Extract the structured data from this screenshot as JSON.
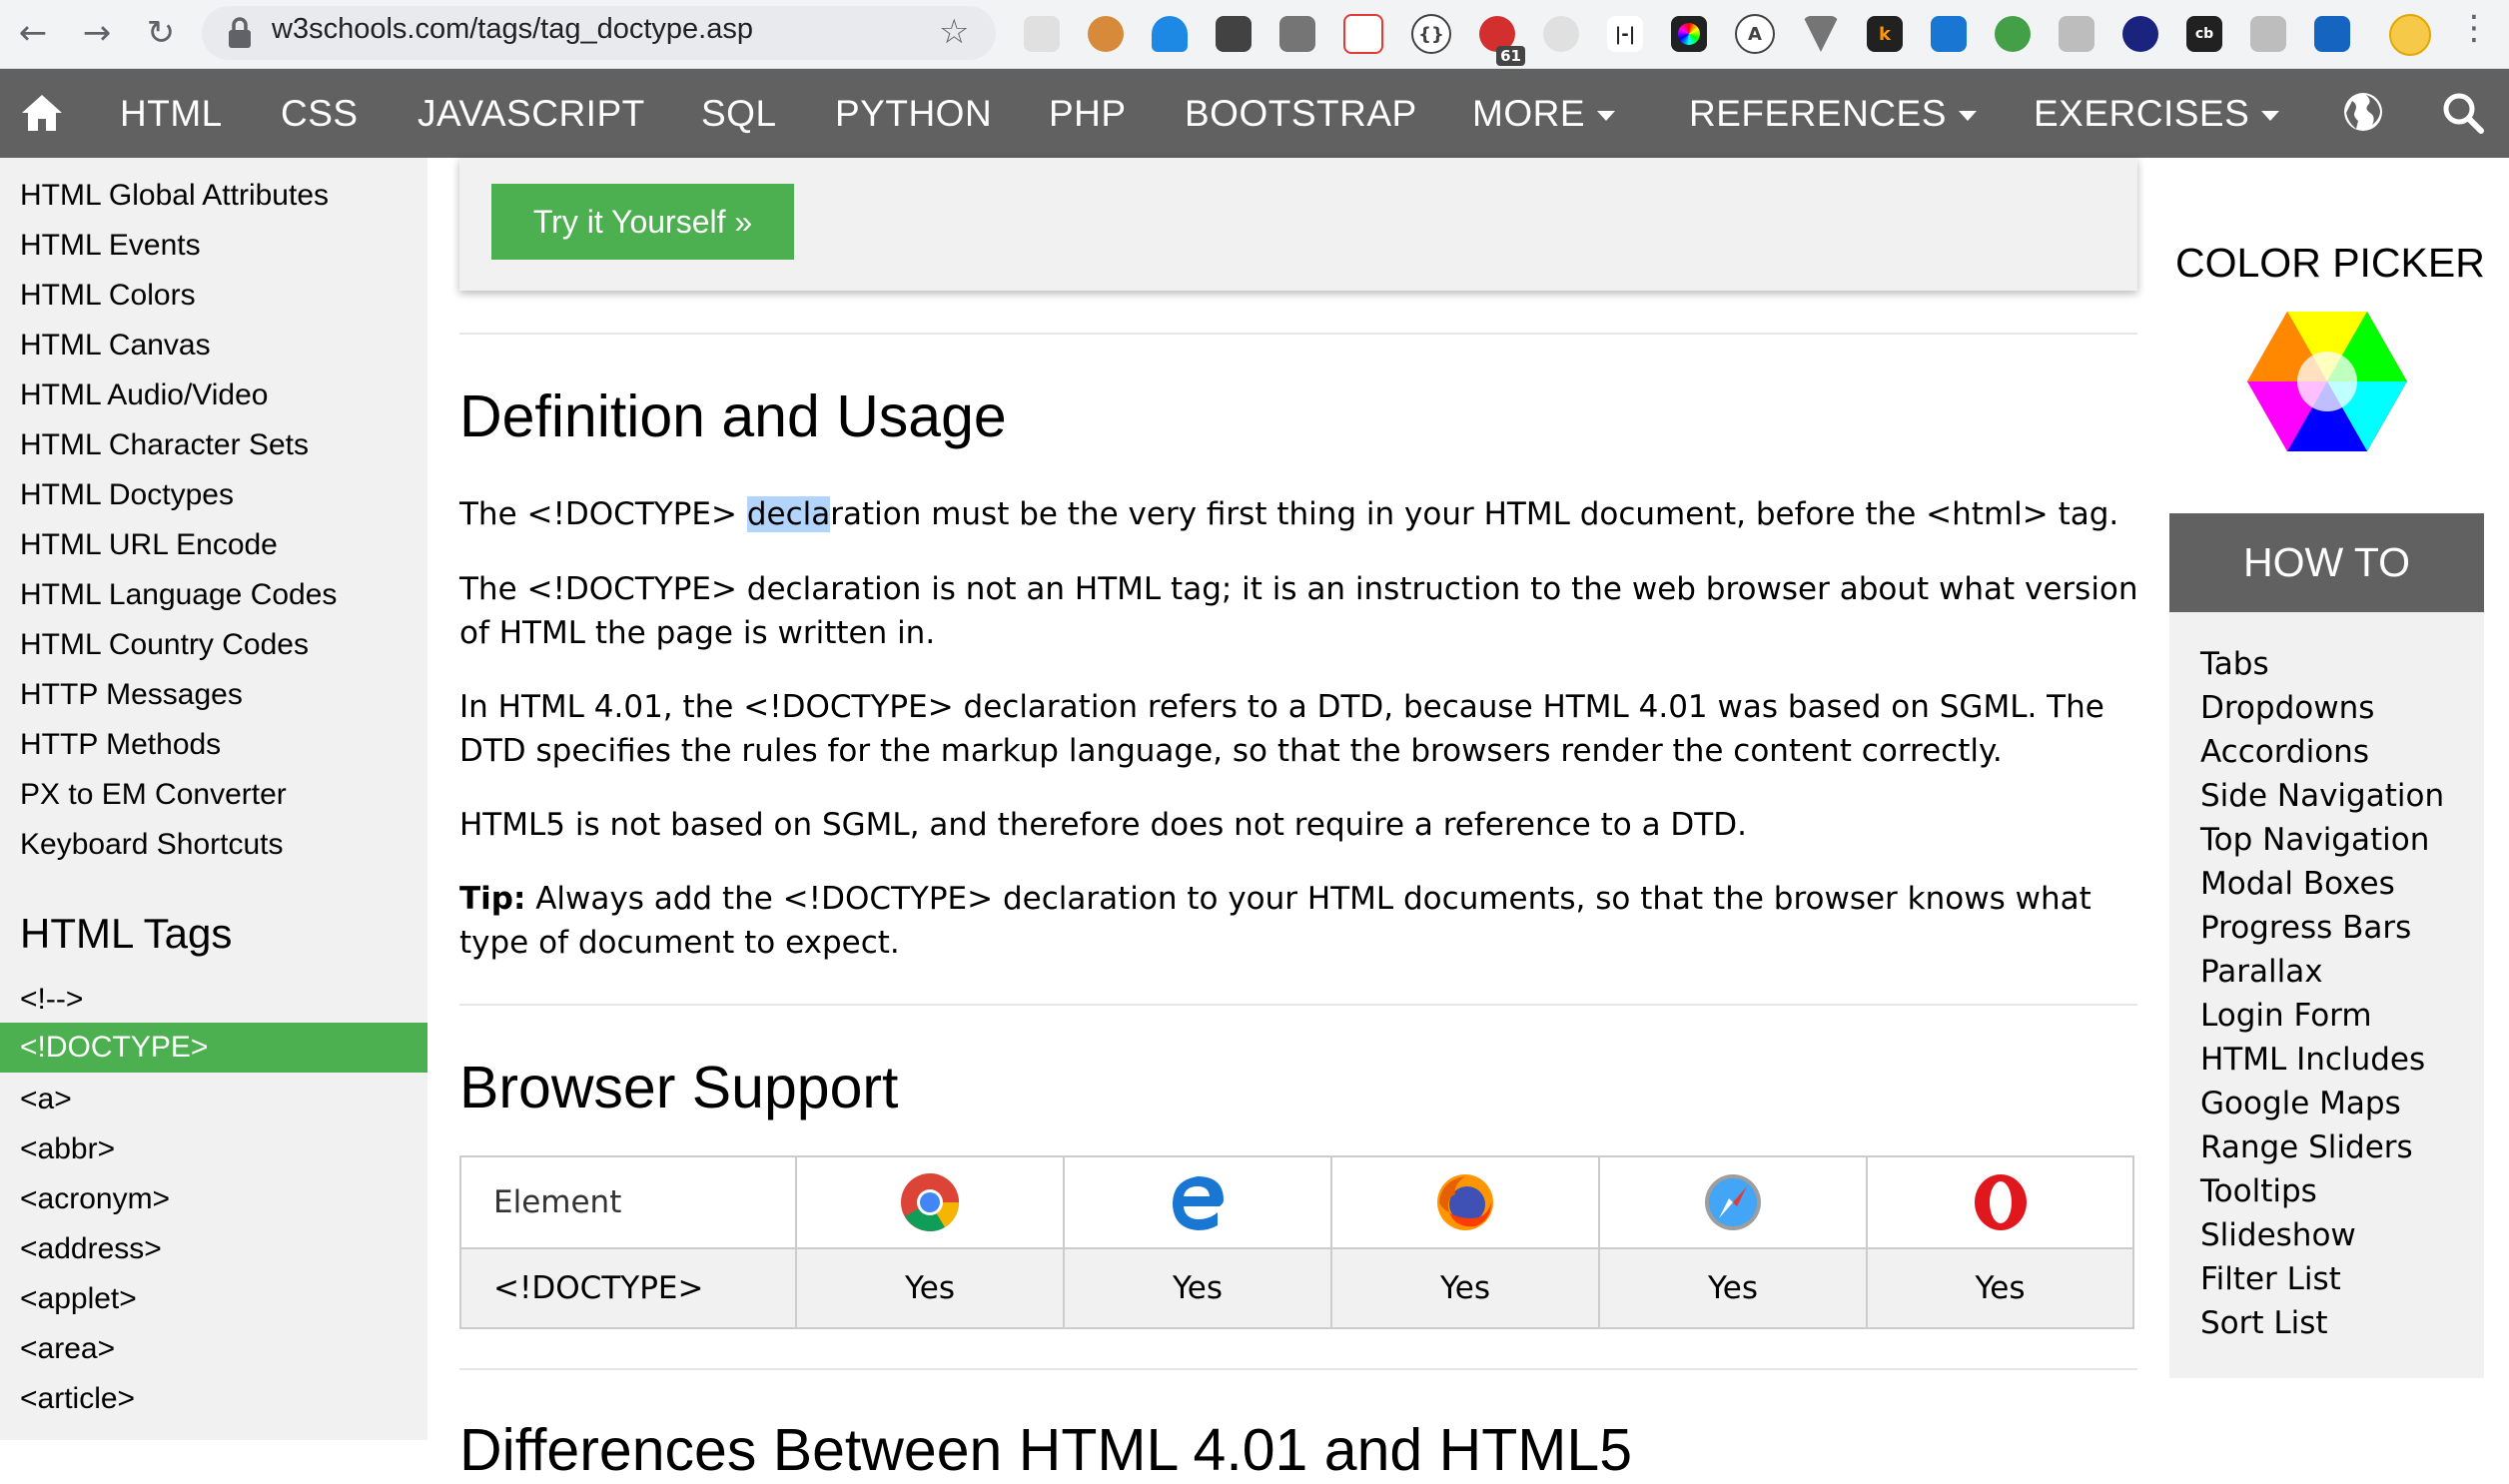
{
  "browser": {
    "url": "w3schools.com/tags/tag_doctype.asp",
    "back_icon": "arrow-left-icon",
    "forward_icon": "arrow-right-icon",
    "reload_icon": "reload-icon",
    "extension_badge": "61"
  },
  "nav": {
    "items": [
      "HTML",
      "CSS",
      "JAVASCRIPT",
      "SQL",
      "PYTHON",
      "PHP",
      "BOOTSTRAP",
      "MORE",
      "REFERENCES",
      "EXERCISES"
    ]
  },
  "sidebar": {
    "reference_links": [
      "HTML Global Attributes",
      "HTML Events",
      "HTML Colors",
      "HTML Canvas",
      "HTML Audio/Video",
      "HTML Character Sets",
      "HTML Doctypes",
      "HTML URL Encode",
      "HTML Language Codes",
      "HTML Country Codes",
      "HTTP Messages",
      "HTTP Methods",
      "PX to EM Converter",
      "Keyboard Shortcuts"
    ],
    "tags_heading": "HTML Tags",
    "tags_before_active": [
      "<!-->"
    ],
    "active_tag": "<!DOCTYPE>",
    "tags_after_active": [
      "<a>",
      "<abbr>",
      "<acronym>",
      "<address>",
      "<applet>",
      "<area>",
      "<article>"
    ]
  },
  "main": {
    "try_button": "Try it Yourself »",
    "definition_heading": "Definition and Usage",
    "p1_before": "The <!DOCTYPE> ",
    "p1_selected": "decla",
    "p1_after": "ration must be the very first thing in your HTML document, before the <html> tag.",
    "p2": "The <!DOCTYPE> declaration is not an HTML tag; it is an instruction to the web browser about what version of HTML the page is written in.",
    "p3": "In HTML 4.01, the <!DOCTYPE> declaration refers to a DTD, because HTML 4.01 was based on SGML. The DTD specifies the rules for the markup language, so that the browsers render the content correctly.",
    "p4": "HTML5 is not based on SGML, and therefore does not require a reference to a DTD.",
    "tip_label": "Tip:",
    "tip_text": " Always add the <!DOCTYPE> declaration to your HTML documents, so that the browser knows what type of document to expect.",
    "browser_support_heading": "Browser Support",
    "table": {
      "header_label": "Element",
      "browser_icons": [
        "chrome-icon",
        "edge-icon",
        "firefox-icon",
        "safari-icon",
        "opera-icon"
      ],
      "row_label": "<!DOCTYPE>",
      "row_values": [
        "Yes",
        "Yes",
        "Yes",
        "Yes",
        "Yes"
      ]
    },
    "next_heading_partial": "Differences Between HTML 4.01 and HTML5"
  },
  "right": {
    "color_picker_title": "COLOR PICKER",
    "howto_title": "HOW TO",
    "howto_items": [
      "Tabs",
      "Dropdowns",
      "Accordions",
      "Side Navigation",
      "Top Navigation",
      "Modal Boxes",
      "Progress Bars",
      "Parallax",
      "Login Form",
      "HTML Includes",
      "Google Maps",
      "Range Sliders",
      "Tooltips",
      "Slideshow",
      "Filter List",
      "Sort List"
    ]
  }
}
